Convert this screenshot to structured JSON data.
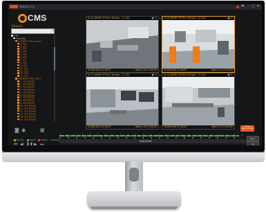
{
  "window": {
    "app_tag": "CMS",
    "title_text": "Search 1 ×"
  },
  "logo": {
    "text": "CMS"
  },
  "left_panel": {
    "label": "Devices",
    "search_placeholder": "",
    "tree": [
      {
        "text": "▾ All",
        "indent": 0,
        "color": "#cfd3d8"
      },
      {
        "text": "▾ My Site",
        "indent": 1,
        "color": "#cfd3d8"
      },
      {
        "text": "▾ CCNVR IP Plus Tempe",
        "indent": 2,
        "color": "#f28a1a"
      },
      {
        "text": "1. C01",
        "indent": 3,
        "color": "#f28a1a"
      },
      {
        "text": "2. C02",
        "indent": 3,
        "color": "#f28a1a"
      },
      {
        "text": "3. C03",
        "indent": 3,
        "color": "#f28a1a"
      },
      {
        "text": "4. C04",
        "indent": 3,
        "color": "#f28a1a"
      },
      {
        "text": "5. C05",
        "indent": 3,
        "color": "#f28a1a"
      },
      {
        "text": "6. C06",
        "indent": 3,
        "color": "#f28a1a"
      },
      {
        "text": "7. C07",
        "indent": 3,
        "color": "#f28a1a"
      },
      {
        "text": "8. C08",
        "indent": 3,
        "color": "#f28a1a"
      },
      {
        "text": "9. C09",
        "indent": 3,
        "color": "#f28a1a"
      },
      {
        "text": "10. C10",
        "indent": 3,
        "color": "#f28a1a"
      },
      {
        "text": "11. C11",
        "indent": 3,
        "color": "#f28a1a"
      },
      {
        "text": "12. C12",
        "indent": 3,
        "color": "#f28a1a"
      },
      {
        "text": "13. C13",
        "indent": 3,
        "color": "#f28a1a"
      },
      {
        "text": "▾ CCNVR IP Plus 32CH",
        "indent": 2,
        "color": "#f28a1a"
      },
      {
        "text": "1. C01 M3205",
        "indent": 3,
        "color": "#f28a1a"
      },
      {
        "text": "2. C02 M3205",
        "indent": 3,
        "color": "#f28a1a"
      },
      {
        "text": "3. C03 M3205",
        "indent": 3,
        "color": "#f28a1a"
      },
      {
        "text": "4. C04 M3205",
        "indent": 3,
        "color": "#f28a1a"
      },
      {
        "text": "5. C05 M3205",
        "indent": 3,
        "color": "#f28a1a"
      },
      {
        "text": "6. C06 M3205",
        "indent": 3,
        "color": "#f28a1a"
      },
      {
        "text": "7. C07 M3205",
        "indent": 3,
        "color": "#f28a1a"
      },
      {
        "text": "8. C08 M3205",
        "indent": 3,
        "color": "#f28a1a"
      },
      {
        "text": "9. C09 M3205",
        "indent": 3,
        "color": "#f28a1a"
      },
      {
        "text": "10. C10 M3205",
        "indent": 3,
        "color": "#f28a1a"
      },
      {
        "text": "11. C11 M3205",
        "indent": 3,
        "color": "#f28a1a"
      },
      {
        "text": "12. C12 M3205",
        "indent": 3,
        "color": "#f28a1a"
      },
      {
        "text": "13. C13 M3205",
        "indent": 3,
        "color": "#f28a1a"
      },
      {
        "text": "14. C14 M3205",
        "indent": 3,
        "color": "#f28a1a"
      },
      {
        "text": "15. C15 M3205",
        "indent": 3,
        "color": "#f28a1a"
      }
    ]
  },
  "cameras": [
    {
      "title": "[4-3] NMH3 IP Plus Tempe - 1 C03",
      "icons": "▣ ⊙",
      "time": "2018/03/09 11:56:07",
      "rate": "Rate:1.00  13:00:00",
      "scene": "room-left"
    },
    {
      "title": "[4-3] NMH3 IP Plus Tempe - 4 C04",
      "icons": "▣ ⊙",
      "time": "2018/03/09 11:56:07",
      "rate": "Rate:1.00  13:00:00",
      "scene": "room-orange"
    },
    {
      "title": "[4-3] NMH3 IP Plus Tempe - 2 C02",
      "icons": "▣ ⊙",
      "time": "2018/03/09 11:56:07",
      "rate": "Rate:1.00  13:00:00",
      "scene": "office"
    },
    {
      "title": "[4-3] NMH3 IP Plus Tempe - 3 C04",
      "icons": "▣ ⊙",
      "time": "2018/03/09 11:56:07",
      "rate": "Rate:1.00  13:00:00",
      "scene": "workbench"
    }
  ],
  "controls": {
    "legend": [
      "Normal",
      "Event",
      "Motion",
      "00:00:00"
    ],
    "legend_colors": [
      "#f28a1a",
      "#3cc15a",
      "#e33b2e",
      "#9ea2a8"
    ],
    "timeline_date": "3/9/2018",
    "export_label": "Export Recordings",
    "side_buttons": [
      "Sync",
      "1x",
      "Normal",
      "Live"
    ]
  },
  "colors": {
    "accent": "#f28a1a",
    "timeline_green": "#3cc15a",
    "timeline_red": "#e33b2e",
    "selected_border": "#f5a623"
  }
}
